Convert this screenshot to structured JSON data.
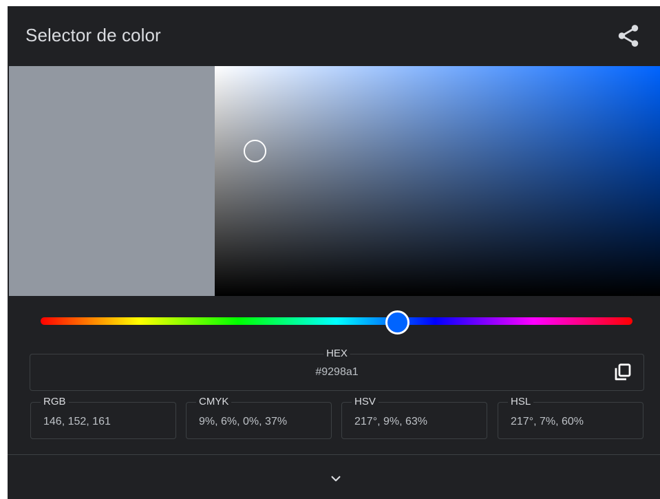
{
  "header": {
    "title": "Selector de color",
    "share_icon": "share-icon"
  },
  "picker": {
    "selected_color": "#9298a1",
    "hue_color": "#0064ff",
    "hue_degrees": 217,
    "saturation_value_marker": {
      "saturation": 9,
      "value": 63
    }
  },
  "hex": {
    "label": "HEX",
    "value": "#9298a1",
    "copy_icon": "copy-icon"
  },
  "formats": [
    {
      "label": "RGB",
      "value": "146, 152, 161"
    },
    {
      "label": "CMYK",
      "value": "9%, 6%, 0%, 37%"
    },
    {
      "label": "HSV",
      "value": "217°, 9%, 63%"
    },
    {
      "label": "HSL",
      "value": "217°, 7%, 60%"
    }
  ],
  "footer": {
    "expand_icon": "chevron-down-icon"
  }
}
